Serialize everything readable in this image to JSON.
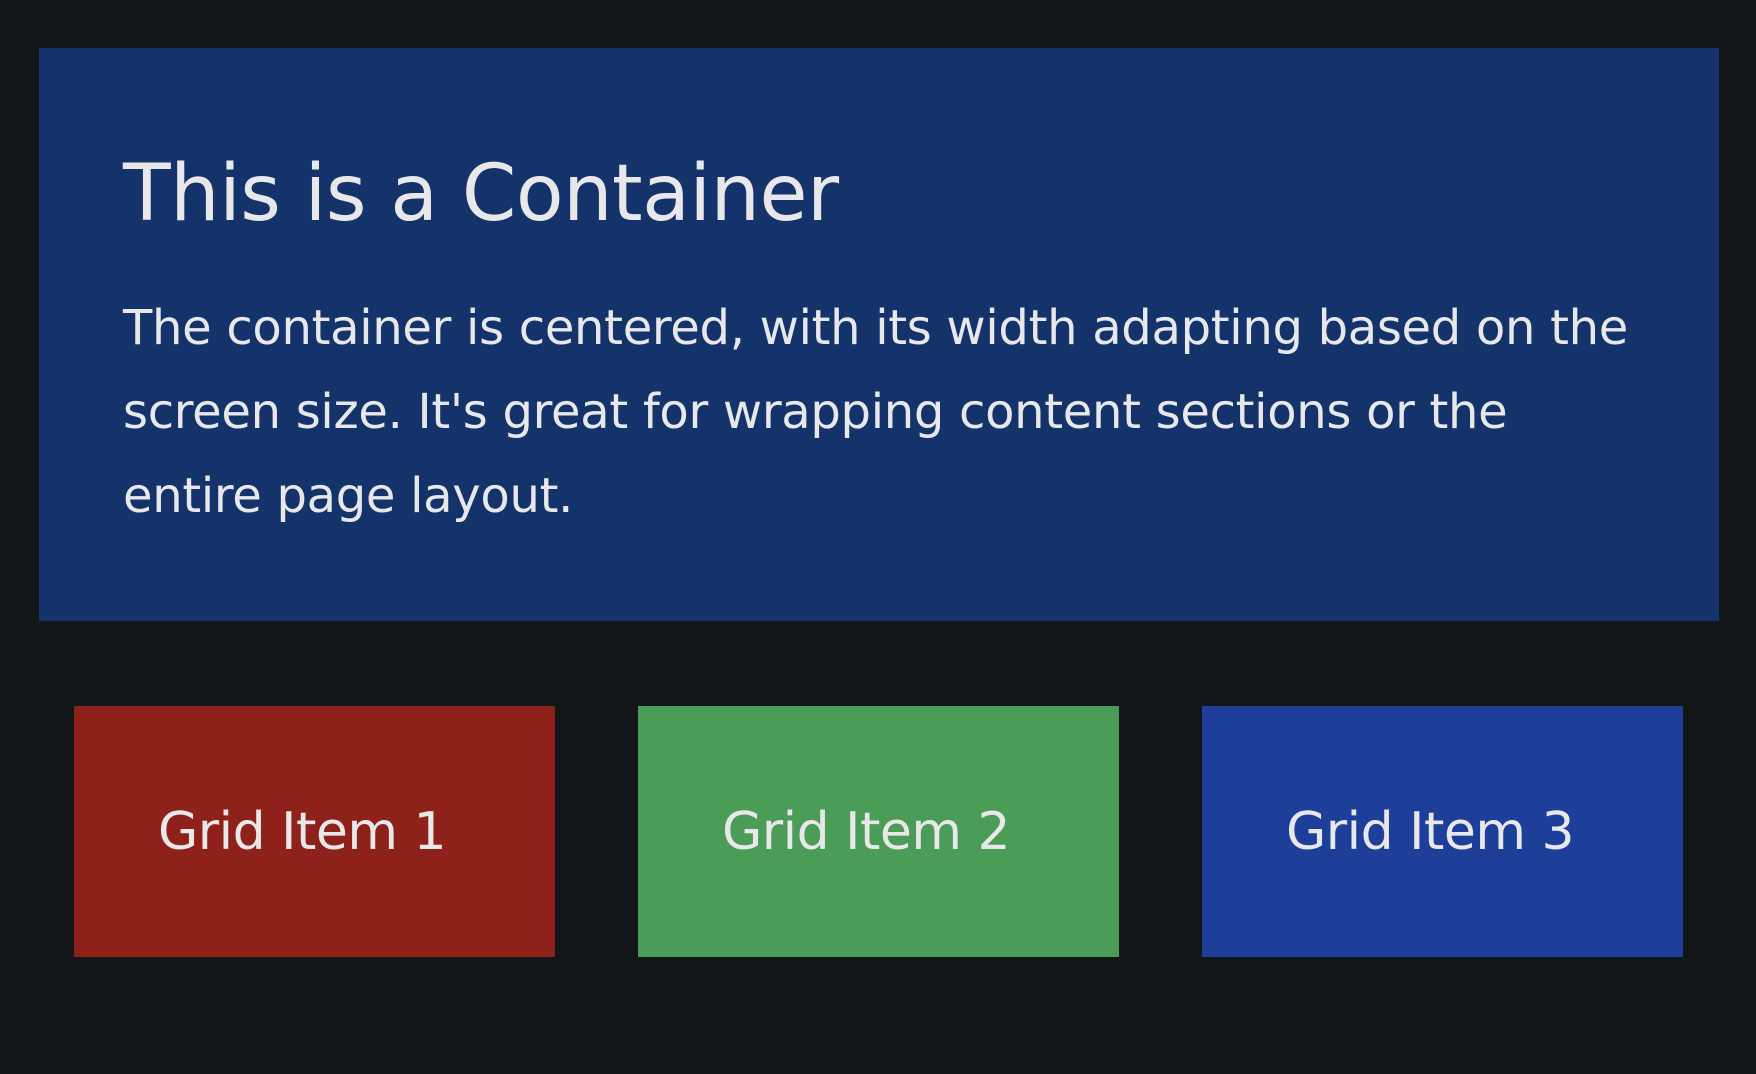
{
  "container": {
    "title": "This is a Container",
    "text": "The container is centered, with its width adapting based on the screen size. It's great for wrapping content sections or the entire page layout.",
    "background": "#14336b"
  },
  "grid": {
    "items": [
      {
        "label": "Grid Item 1",
        "color": "#8f211b"
      },
      {
        "label": "Grid Item 2",
        "color": "#4a9c56"
      },
      {
        "label": "Grid Item 3",
        "color": "#1d3f99"
      }
    ]
  },
  "colors": {
    "page_background": "#121619",
    "text": "#e8e8ea"
  }
}
